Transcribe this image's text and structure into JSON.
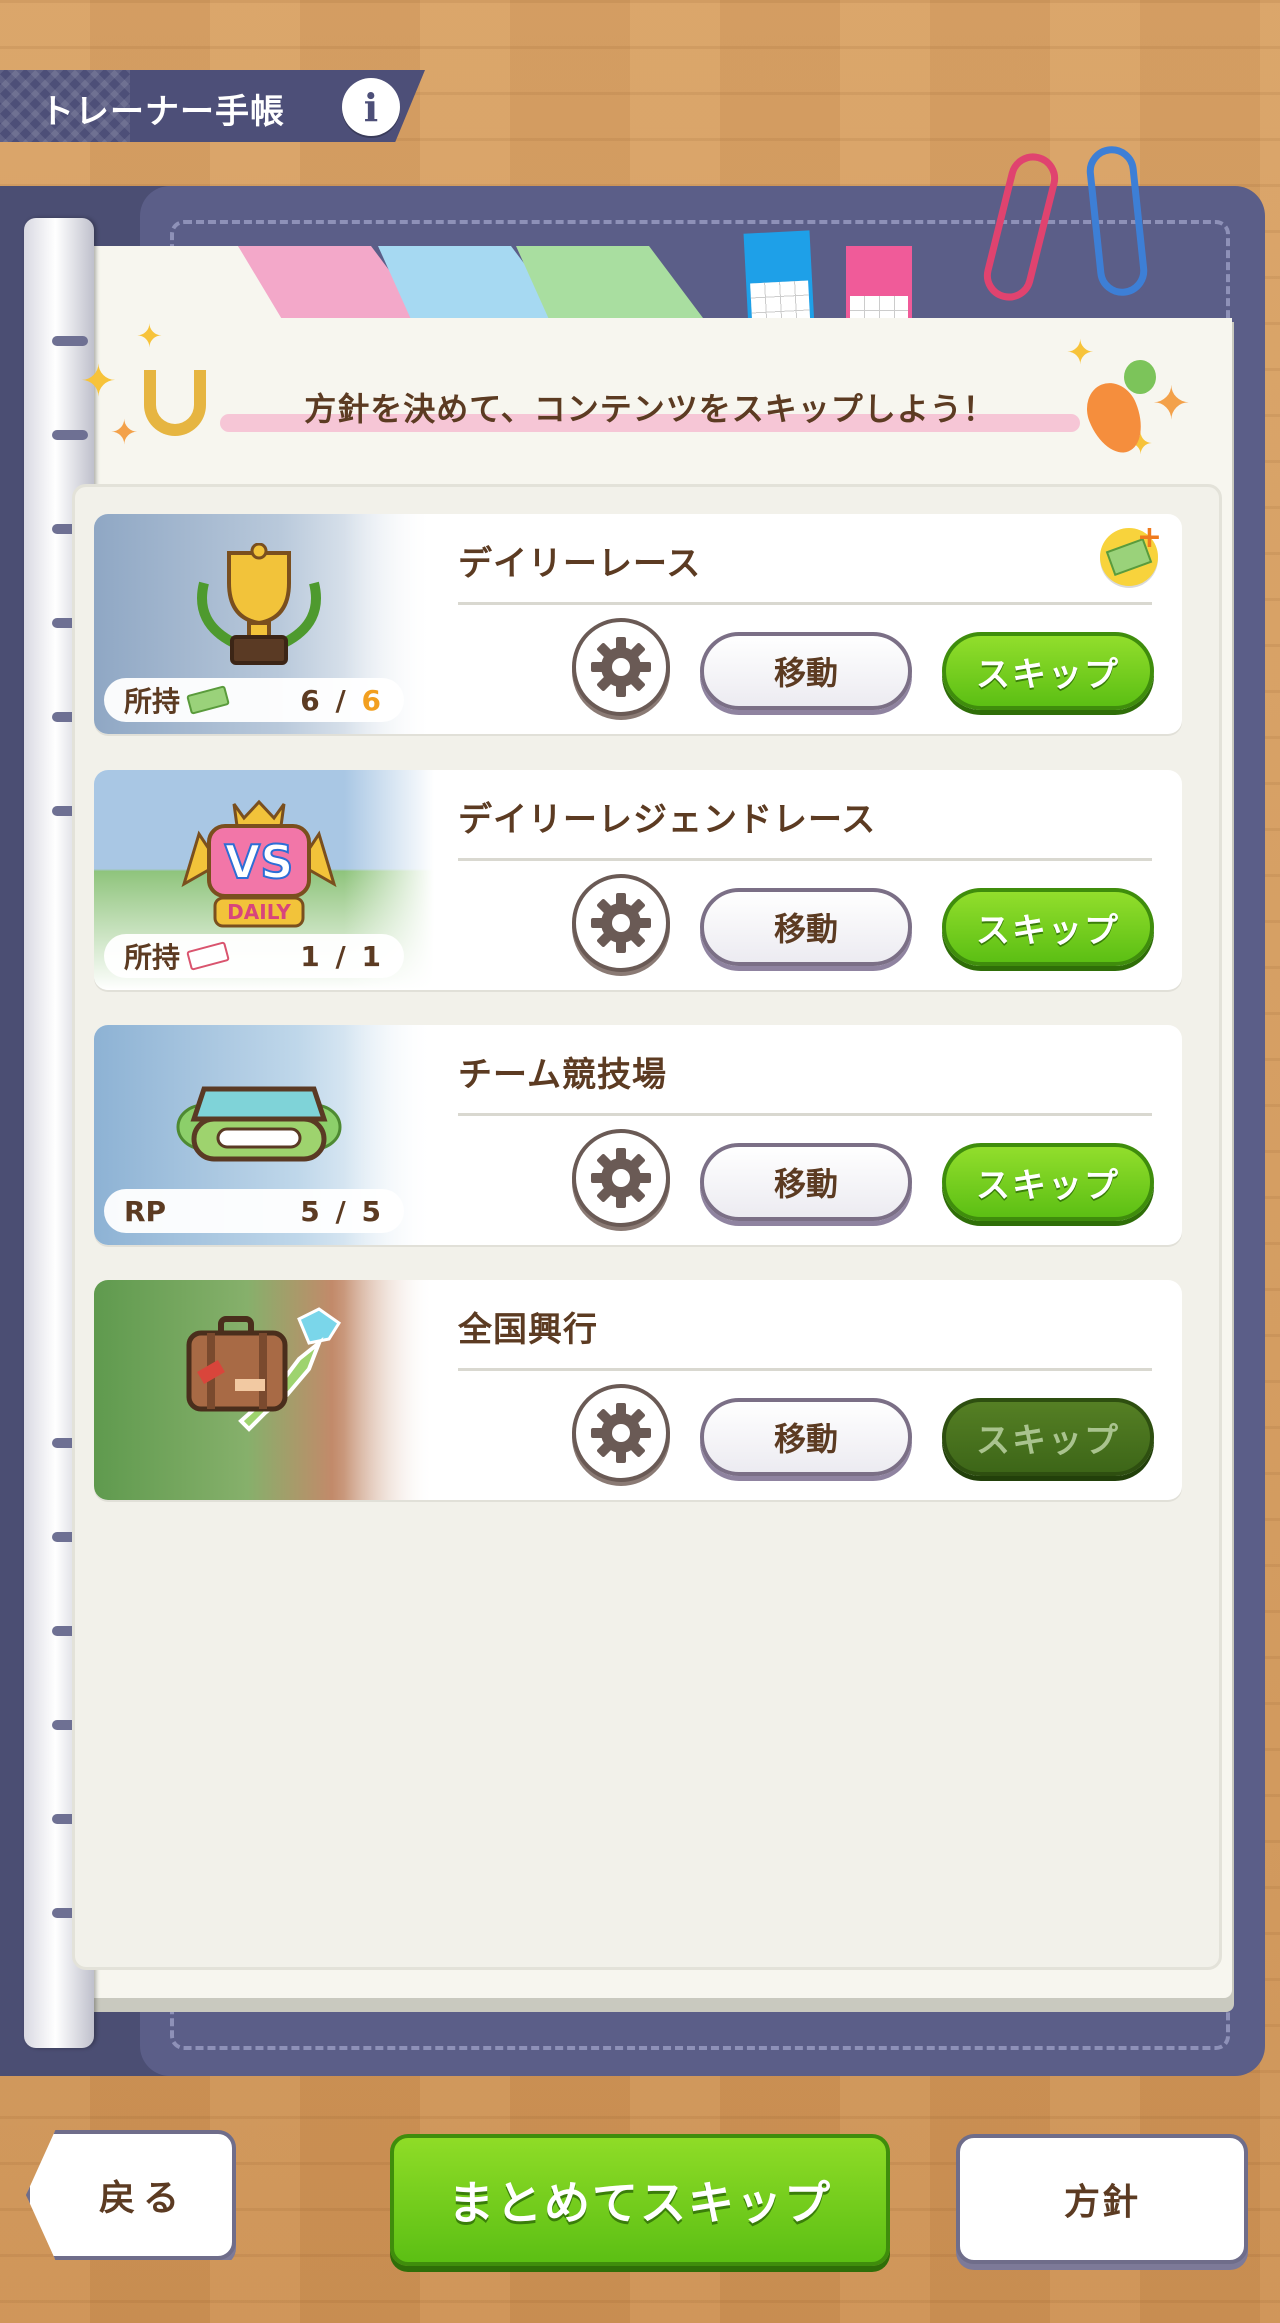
{
  "header": {
    "title": "トレーナー手帳",
    "info_icon": "i"
  },
  "slogan": "方針を決めて、コンテンツをスキップしよう！",
  "items": [
    {
      "title": "デイリーレース",
      "badge_label": "所持",
      "count_current": "6",
      "count_sep": " / ",
      "count_max": "6",
      "max_highlight": true,
      "move_label": "移動",
      "skip_label": "スキップ",
      "skip_enabled": true,
      "has_shop_icon": true,
      "icon": "trophy-icon"
    },
    {
      "title": "デイリーレジェンドレース",
      "badge_label": "所持",
      "count_current": "1",
      "count_sep": " / ",
      "count_max": "1",
      "max_highlight": false,
      "move_label": "移動",
      "skip_label": "スキップ",
      "skip_enabled": true,
      "icon": "vs-daily-icon"
    },
    {
      "title": "チーム競技場",
      "badge_label": "RP",
      "count_current": "5",
      "count_sep": " / ",
      "count_max": "5",
      "max_highlight": false,
      "move_label": "移動",
      "skip_label": "スキップ",
      "skip_enabled": true,
      "icon": "stadium-icon"
    },
    {
      "title": "全国興行",
      "move_label": "移動",
      "skip_label": "スキップ",
      "skip_enabled": false,
      "icon": "suitcase-map-icon"
    }
  ],
  "footer": {
    "back_label": "戻る",
    "all_skip_label": "まとめてスキップ",
    "policy_label": "方針"
  },
  "colors": {
    "accent_green": "#5cbf14",
    "text_brown": "#5c3b22",
    "binder_navy": "#4b4e73",
    "count_highlight": "#f29f1f"
  }
}
